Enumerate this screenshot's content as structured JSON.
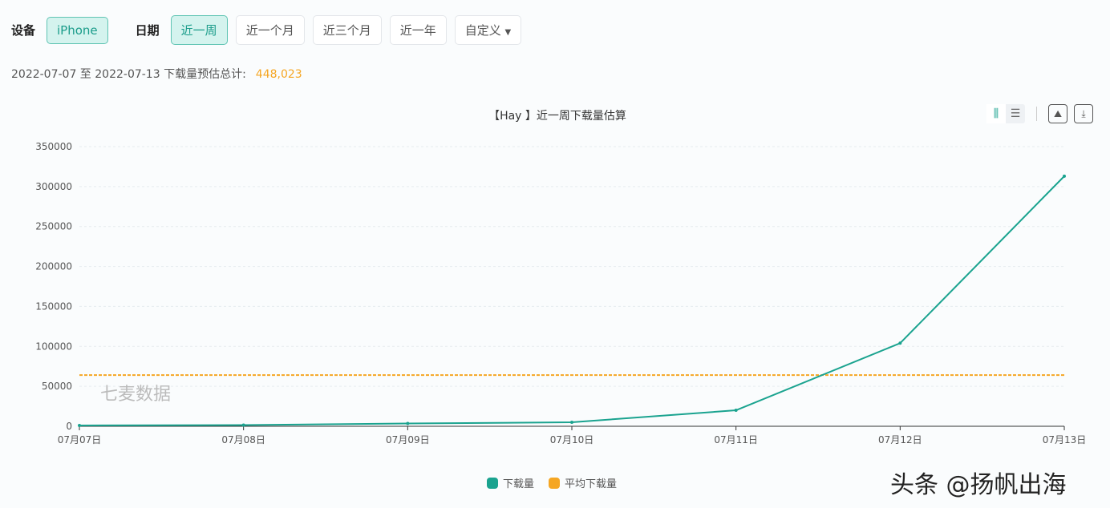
{
  "filters": {
    "device_label": "设备",
    "device": "iPhone",
    "date_label": "日期",
    "ranges": [
      "近一周",
      "近一个月",
      "近三个月",
      "近一年"
    ],
    "custom": "自定义",
    "active_range": 0
  },
  "summary": {
    "text": "2022-07-07 至 2022-07-13 下载量预估总计:",
    "total": "448,023"
  },
  "toolbar": {
    "icons": [
      "bar-chart-icon",
      "list-icon",
      "image-save-icon",
      "download-icon"
    ]
  },
  "watermark_inner": "七麦数据",
  "watermark": "头条 @扬帆出海",
  "colors": {
    "series": "#1aa38f",
    "average": "#f5a623"
  },
  "chart_data": {
    "type": "line",
    "title": "【Hay 】近一周下载量估算",
    "categories": [
      "07月07日",
      "07月08日",
      "07月09日",
      "07月10日",
      "07月11日",
      "07月12日",
      "07月13日"
    ],
    "series": [
      {
        "name": "下载量",
        "values": [
          1000,
          1500,
          3500,
          5000,
          20000,
          104000,
          313023
        ]
      }
    ],
    "average": {
      "name": "平均下载量",
      "value": 64003
    },
    "ylim": [
      0,
      350000
    ],
    "yticks": [
      0,
      50000,
      100000,
      150000,
      200000,
      250000,
      300000,
      350000
    ],
    "grid": true,
    "legend": "bottom-center"
  }
}
